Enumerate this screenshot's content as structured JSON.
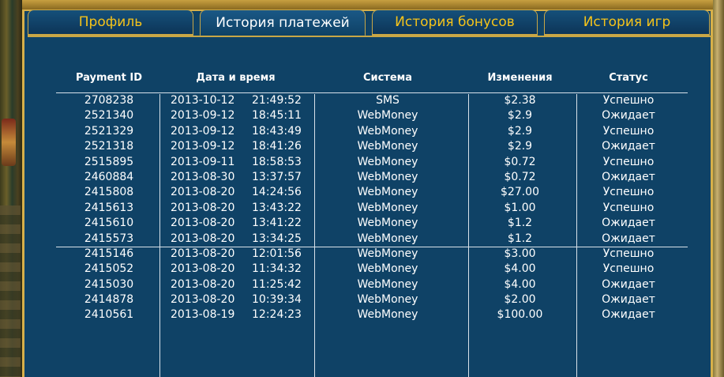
{
  "tabs": [
    {
      "label": "Профиль",
      "active": false
    },
    {
      "label": "История платежей",
      "active": true
    },
    {
      "label": "История бонусов",
      "active": false
    },
    {
      "label": "История игр",
      "active": false
    }
  ],
  "table": {
    "headers": {
      "id": "Payment ID",
      "datetime": "Дата и время",
      "system": "Система",
      "change": "Изменения",
      "status": "Статус"
    },
    "rows": [
      {
        "id": "2708238",
        "date": "2013-10-12",
        "time": "21:49:52",
        "system": "SMS",
        "change": "$2.38",
        "status": "Успешно"
      },
      {
        "id": "2521340",
        "date": "2013-09-12",
        "time": "18:45:11",
        "system": "WebMoney",
        "change": "$2.9",
        "status": "Ожидает"
      },
      {
        "id": "2521329",
        "date": "2013-09-12",
        "time": "18:43:49",
        "system": "WebMoney",
        "change": "$2.9",
        "status": "Успешно"
      },
      {
        "id": "2521318",
        "date": "2013-09-12",
        "time": "18:41:26",
        "system": "WebMoney",
        "change": "$2.9",
        "status": "Ожидает"
      },
      {
        "id": "2515895",
        "date": "2013-09-11",
        "time": "18:58:53",
        "system": "WebMoney",
        "change": "$0.72",
        "status": "Успешно"
      },
      {
        "id": "2460884",
        "date": "2013-08-30",
        "time": "13:37:57",
        "system": "WebMoney",
        "change": "$0.72",
        "status": "Ожидает"
      },
      {
        "id": "2415808",
        "date": "2013-08-20",
        "time": "14:24:56",
        "system": "WebMoney",
        "change": "$27.00",
        "status": "Успешно"
      },
      {
        "id": "2415613",
        "date": "2013-08-20",
        "time": "13:43:22",
        "system": "WebMoney",
        "change": "$1.00",
        "status": "Успешно"
      },
      {
        "id": "2415610",
        "date": "2013-08-20",
        "time": "13:41:22",
        "system": "WebMoney",
        "change": "$1.2",
        "status": "Ожидает"
      },
      {
        "id": "2415573",
        "date": "2013-08-20",
        "time": "13:34:25",
        "system": "WebMoney",
        "change": "$1.2",
        "status": "Ожидает"
      },
      {
        "id": "2415146",
        "date": "2013-08-20",
        "time": "12:01:56",
        "system": "WebMoney",
        "change": "$3.00",
        "status": "Успешно"
      },
      {
        "id": "2415052",
        "date": "2013-08-20",
        "time": "11:34:32",
        "system": "WebMoney",
        "change": "$4.00",
        "status": "Успешно"
      },
      {
        "id": "2415030",
        "date": "2013-08-20",
        "time": "11:25:42",
        "system": "WebMoney",
        "change": "$4.00",
        "status": "Ожидает"
      },
      {
        "id": "2414878",
        "date": "2013-08-20",
        "time": "10:39:34",
        "system": "WebMoney",
        "change": "$2.00",
        "status": "Ожидает"
      },
      {
        "id": "2410561",
        "date": "2013-08-19",
        "time": "12:24:23",
        "system": "WebMoney",
        "change": "$100.00",
        "status": "Ожидает"
      }
    ]
  },
  "colors": {
    "panel_bg": "#0f4266",
    "tab_text": "#f5c31a",
    "tab_border": "#c9a746"
  }
}
